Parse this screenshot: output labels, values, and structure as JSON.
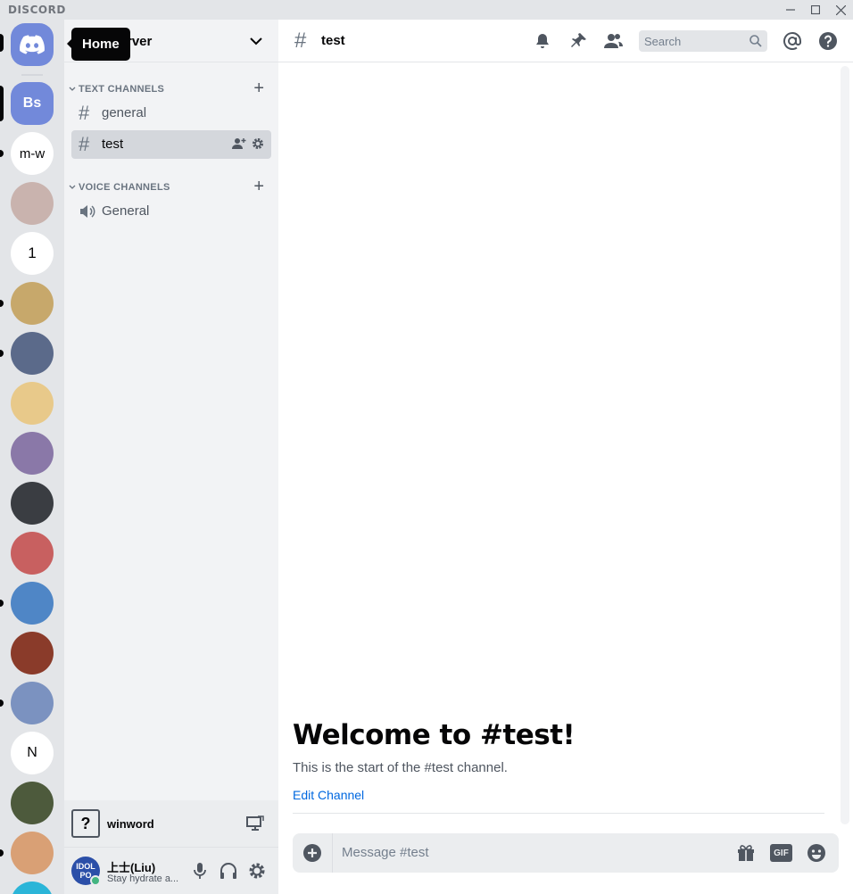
{
  "window": {
    "brand": "DISCORD",
    "controls": [
      "minimize",
      "maximize",
      "close"
    ]
  },
  "tooltip": {
    "text": "Home"
  },
  "rail": {
    "servers": [
      {
        "label": "Bs",
        "color": "#7289da"
      },
      {
        "label": "m-w",
        "color": "#ffffff"
      },
      {
        "label": "",
        "color": "#c9b3ae"
      },
      {
        "label": "1",
        "color": "#ffffff"
      },
      {
        "label": "",
        "color": "#c7a86b"
      },
      {
        "label": "",
        "color": "#5b6a8a"
      },
      {
        "label": "",
        "color": "#e8c98a"
      },
      {
        "label": "",
        "color": "#8a78a8"
      },
      {
        "label": "",
        "color": "#3a3d42"
      },
      {
        "label": "",
        "color": "#c86060"
      },
      {
        "label": "",
        "color": "#4f86c6"
      },
      {
        "label": "",
        "color": "#8a3b2a"
      },
      {
        "label": "",
        "color": "#7b92c0"
      },
      {
        "label": "N",
        "color": "#ffffff"
      },
      {
        "label": "",
        "color": "#4d5a3c"
      },
      {
        "label": "",
        "color": "#d9a075"
      },
      {
        "label": "",
        "color": "#2bb5d8"
      }
    ]
  },
  "server": {
    "name": "rver",
    "categories": [
      {
        "label": "TEXT CHANNELS",
        "channels": [
          "general",
          "test"
        ]
      },
      {
        "label": "VOICE CHANNELS",
        "channels": [
          "General"
        ]
      }
    ]
  },
  "voice_panel": {
    "name": "winword",
    "icon": "question-mark"
  },
  "user": {
    "avatar_text": "IDOL PO",
    "name": "上士(Liu)",
    "status": "Stay hydrate a...",
    "status_color": "#43b581"
  },
  "channel": {
    "name": "test",
    "search_placeholder": "Search",
    "welcome": "Welcome to #test!",
    "start_text": "This is the start of the #test channel.",
    "edit_link": "Edit Channel",
    "message_placeholder": "Message #test",
    "gif_label": "GIF"
  }
}
